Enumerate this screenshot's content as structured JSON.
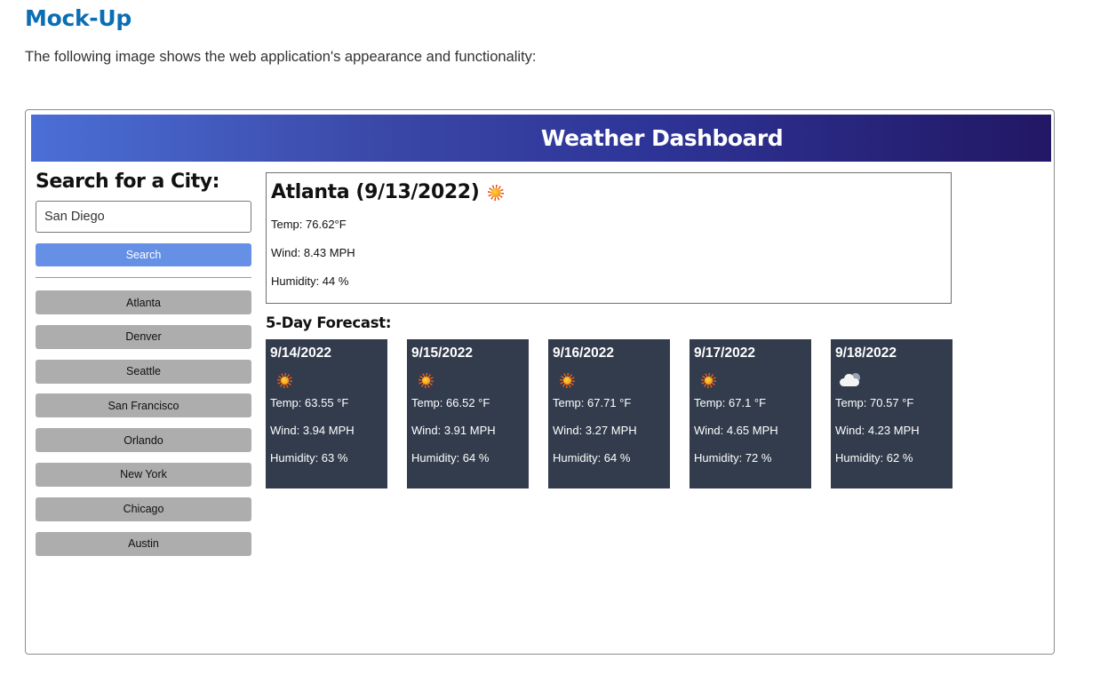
{
  "doc": {
    "title": "Mock-Up",
    "intro": "The following image shows the web application's appearance and functionality:"
  },
  "app": {
    "header_title": "Weather Dashboard",
    "sidebar": {
      "heading": "Search for a City:",
      "search_input_value": "San Diego",
      "search_button_label": "Search",
      "history": [
        "Atlanta",
        "Denver",
        "Seattle",
        "San Francisco",
        "Orlando",
        "New York",
        "Chicago",
        "Austin"
      ]
    },
    "current": {
      "title": "Atlanta (9/13/2022)",
      "icon": "sun-icon",
      "temp": "Temp: 76.62°F",
      "wind": "Wind: 8.43 MPH",
      "humidity": "Humidity: 44 %"
    },
    "forecast": {
      "heading": "5-Day Forecast:",
      "days": [
        {
          "date": "9/14/2022",
          "icon": "sun-icon",
          "temp": "Temp: 63.55 °F",
          "wind": "Wind: 3.94 MPH",
          "humidity": "Humidity: 63 %"
        },
        {
          "date": "9/15/2022",
          "icon": "sun-icon",
          "temp": "Temp: 66.52 °F",
          "wind": "Wind: 3.91 MPH",
          "humidity": "Humidity: 64 %"
        },
        {
          "date": "9/16/2022",
          "icon": "sun-icon",
          "temp": "Temp: 67.71 °F",
          "wind": "Wind: 3.27 MPH",
          "humidity": "Humidity: 64 %"
        },
        {
          "date": "9/17/2022",
          "icon": "sun-icon",
          "temp": "Temp: 67.1 °F",
          "wind": "Wind: 4.65 MPH",
          "humidity": "Humidity: 72 %"
        },
        {
          "date": "9/18/2022",
          "icon": "cloud-icon",
          "temp": "Temp: 70.57 °F",
          "wind": "Wind: 4.23 MPH",
          "humidity": "Humidity: 62 %"
        }
      ]
    }
  },
  "colors": {
    "doc_title": "#0a6eb4",
    "header_gradient_start": "#4b6fd6",
    "header_gradient_end": "#221764",
    "search_button": "#6690e6",
    "history_button": "#adadad",
    "forecast_card": "#333c4d"
  }
}
